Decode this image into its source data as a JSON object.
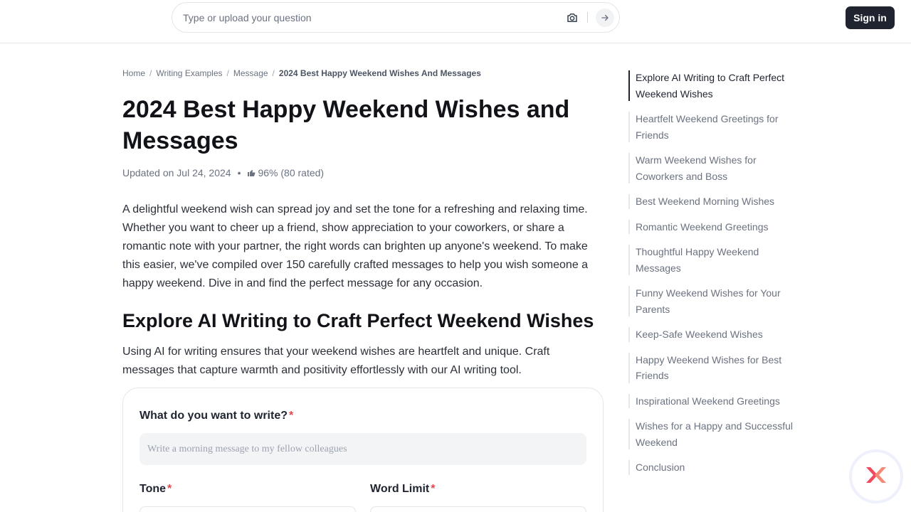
{
  "header": {
    "search": {
      "placeholder": "Type or upload your question",
      "value": ""
    },
    "signin_label": "Sign in"
  },
  "breadcrumb": {
    "items": [
      "Home",
      "Writing Examples",
      "Message"
    ],
    "current": "2024 Best Happy Weekend Wishes And Messages"
  },
  "article": {
    "title": "2024 Best Happy Weekend Wishes and Messages",
    "updated": "Updated on Jul 24, 2024",
    "rating": "96% (80 rated)",
    "intro": "A delightful weekend wish can spread joy and set the tone for a refreshing and relaxing time. Whether you want to cheer up a friend, show appreciation to your coworkers, or share a romantic note with your partner, the right words can brighten up anyone's weekend. To make this easier, we've compiled over 150 carefully crafted messages to help you wish someone a happy weekend. Dive in and find the perfect message for any occasion.",
    "section_title": "Explore AI Writing to Craft Perfect Weekend Wishes",
    "section_desc": "Using AI for writing ensures that your weekend wishes are heartfelt and unique. Craft messages that capture warmth and positivity effortlessly with our AI writing tool."
  },
  "form": {
    "write_label": "What do you want to write?",
    "write_placeholder": "Write a morning message to my fellow colleagues",
    "tone_label": "Tone",
    "word_limit_label": "Word Limit",
    "required_mark": "*"
  },
  "toc": {
    "items": [
      "Explore AI Writing to Craft Perfect Weekend Wishes",
      "Heartfelt Weekend Greetings for Friends",
      "Warm Weekend Wishes for Coworkers and Boss",
      "Best Weekend Morning Wishes",
      "Romantic Weekend Greetings",
      "Thoughtful Happy Weekend Messages",
      "Funny Weekend Wishes for Your Parents",
      "Keep-Safe Weekend Wishes",
      "Happy Weekend Wishes for Best Friends",
      "Inspirational Weekend Greetings",
      "Wishes for a Happy and Successful Weekend",
      "Conclusion"
    ],
    "active_index": 0
  },
  "icons": {
    "search_upload": "camera-icon",
    "search_submit": "arrow-right-icon",
    "rating": "thumbs-up-icon",
    "assistant": "assistant-logo-icon"
  },
  "colors": {
    "primary_dark": "#1f2430",
    "required": "#e5484d",
    "assistant_brand": "#ef4a5f"
  }
}
